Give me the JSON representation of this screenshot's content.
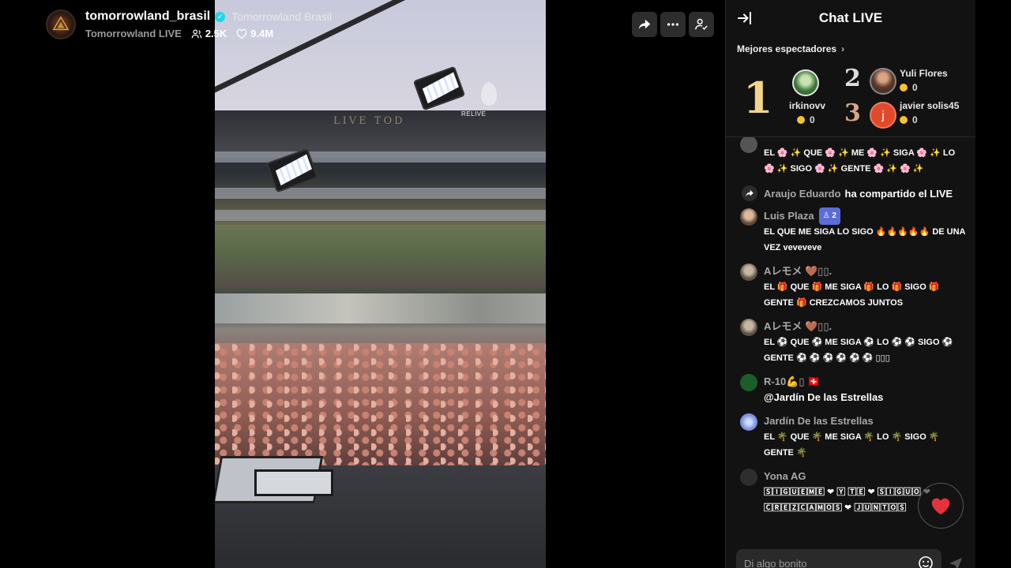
{
  "host": {
    "username": "tomorrowland_brasil",
    "display_name": "Tomorrowland Brasil",
    "subtitle": "Tomorrowland LIVE",
    "viewers": "2.5K",
    "likes": "9.4M"
  },
  "video": {
    "overlay_label": "RELIVE",
    "roof_text": "LIVE TOD"
  },
  "chat": {
    "title": "Chat LIVE",
    "top_viewers_title": "Mejores espectadores",
    "top_viewers": [
      {
        "rank": "1",
        "name": "irkinovv",
        "coins": "0"
      },
      {
        "rank": "2",
        "name": "Yuli Flores",
        "coins": "0"
      },
      {
        "rank": "3",
        "name": "javier solis45",
        "coins": "0",
        "initial": "j"
      }
    ],
    "messages": [
      {
        "user": "",
        "text": "EL 🌸 ✨ QUE 🌸 ✨ ME 🌸 ✨ SIGA 🌸 ✨ LO 🌸 ✨ SIGO 🌸 ✨ GENTE 🌸 ✨ 🌸 ✨"
      },
      {
        "type": "share",
        "user": "Araujo Eduardo",
        "text": "ha compartido el LIVE"
      },
      {
        "user": "Luis Plaza",
        "badge": "2",
        "text": "EL QUE ME SIGA LO SIGO 🔥🔥🔥🔥🔥 DE UNA VEZ veveveve"
      },
      {
        "user": "Aレモメ 🤎▯▯.",
        "text": "EL 🎁 QUE 🎁 ME SIGA 🎁 LO 🎁 SIGO 🎁 GENTE 🎁 CREZCAMOS JUNTOS"
      },
      {
        "user": "Aレモメ 🤎▯▯.",
        "text": "EL ⚽ QUE ⚽ ME SIGA ⚽ LO ⚽ ⚽ SIGO ⚽ GENTE ⚽ ⚽ ⚽ ⚽ ⚽ ⚽ ▯▯▯"
      },
      {
        "user": "R-10💪▯ 🇨🇭",
        "text": "@Jardín De las Estrellas"
      },
      {
        "user": "Jardín De las Estrellas",
        "text": "EL 🌴 QUE 🌴 ME SIGA 🌴 LO 🌴 SIGO 🌴 GENTE 🌴"
      },
      {
        "user": "Yona AG",
        "text": "🅂🄸🄶🅄🄴🄼🄴 ❤ 🅈 🅃🄴 ❤ 🅂🄸🄶🅄🄾 ❤ 🄲🅁🄴🅉🄲🄰🄼🄾🅂 ❤ 🄹🅄🄽🅃🄾🅂"
      }
    ],
    "input_placeholder": "Di algo bonito"
  },
  "colors": {
    "accent": "#20d5ec",
    "gold": "#f2d58b",
    "coin": "#f2c230",
    "heart": "#e5323c"
  },
  "icons": [
    "share-icon",
    "more-icon",
    "user-check-icon",
    "collapse-icon",
    "people-icon",
    "heart-icon",
    "emoji-icon",
    "send-icon"
  ]
}
